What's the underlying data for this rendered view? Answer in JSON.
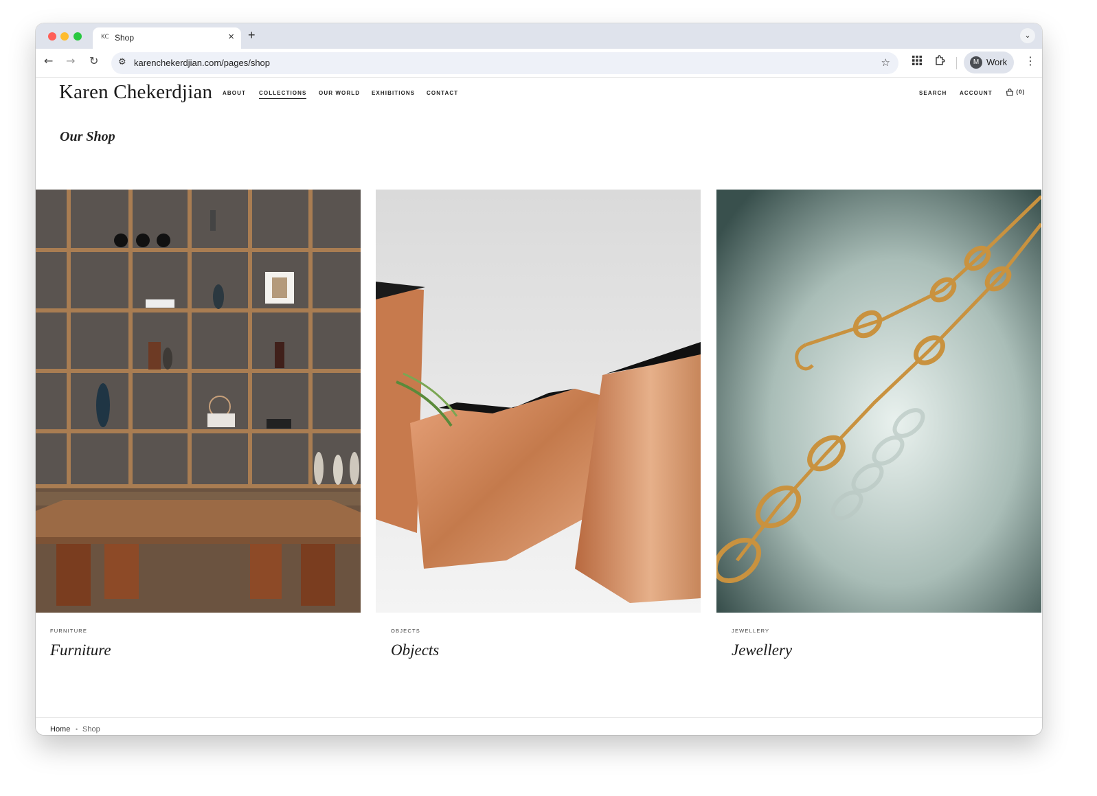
{
  "browser": {
    "tab_title": "Shop",
    "tab_favicon": "KC",
    "new_tab": "+",
    "url": "karenchekerdjian.com/pages/shop",
    "profile_initial": "M",
    "profile_label": "Work"
  },
  "site": {
    "logo": "Karen Chekerdjian",
    "nav": [
      "ABOUT",
      "COLLECTIONS",
      "OUR WORLD",
      "EXHIBITIONS",
      "CONTACT"
    ],
    "active_nav": "COLLECTIONS",
    "utility": {
      "search": "SEARCH",
      "account": "ACCOUNT",
      "cart": "(0)"
    }
  },
  "page": {
    "title": "Our Shop"
  },
  "cards": [
    {
      "eyebrow": "FURNITURE",
      "title": "Furniture"
    },
    {
      "eyebrow": "OBJECTS",
      "title": "Objects"
    },
    {
      "eyebrow": "JEWELLERY",
      "title": "Jewellery"
    }
  ],
  "breadcrumb": {
    "home": "Home",
    "separator": "•",
    "current": "Shop"
  },
  "icons": {
    "back": "arrow-left-icon",
    "forward": "arrow-right-icon",
    "reload": "reload-icon",
    "site_info": "tune-icon",
    "bookmark": "star-icon",
    "apps": "grid-icon",
    "extensions": "puzzle-icon",
    "menu": "kebab-icon",
    "cart": "bag-icon"
  }
}
